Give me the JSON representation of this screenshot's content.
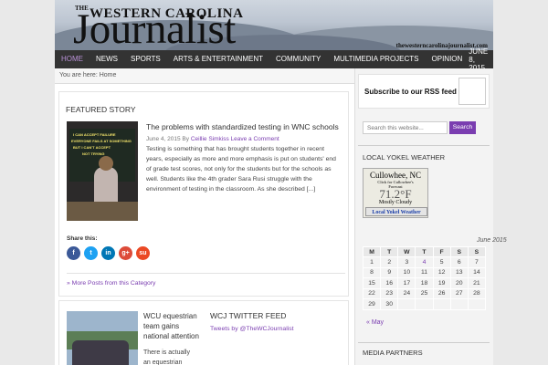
{
  "header": {
    "logo_the": "THE",
    "logo_western": "WESTERN CAROLINA",
    "logo_main": "Journalist",
    "logo_url": "thewesterncarolinajournalist.com"
  },
  "nav": {
    "items": [
      "Home",
      "News",
      "Sports",
      "Arts & Entertainment",
      "Community",
      "Multimedia Projects",
      "Opinion"
    ],
    "date": "June 8, 2015"
  },
  "breadcrumb": "You are here: Home",
  "featured": {
    "section_title": "Featured Story",
    "image_text": [
      "I CAN ACCEPT FAILURE",
      "EVERYONE FAILS AT SOMETHING",
      "BUT I CAN'T ACCEPT",
      "NOT TRYING"
    ],
    "title": "The problems with standardized testing in WNC schools",
    "date": "June 4, 2015",
    "by": "By",
    "author": "Ceillie Simkiss",
    "comment_link": "Leave a Comment",
    "excerpt": "Testing is something that has brought students together in recent years, especially as more and more emphasis is put on students' end of grade test scores, not only for the students but for the schools as well. Students like the 4th grader Sara Rusi struggle with the environment of testing in the classroom. As she described [...]",
    "share_label": "Share this:",
    "share_buttons": [
      "f",
      "t",
      "in",
      "g+",
      "su"
    ],
    "more_posts": "More Posts from this Category"
  },
  "second": {
    "title": "WCU equestrian team gains national attention",
    "excerpt": "There is actually an equestrian",
    "twitter_title": "WCJ Twitter Feed",
    "twitter_link": "Tweets by @TheWCJournalist"
  },
  "sidebar": {
    "rss_text": "Subscribe to our RSS feed",
    "search_placeholder": "Search this website...",
    "search_button": "Search",
    "weather_title": "Local Yokel Weather",
    "weather": {
      "city": "Cullowhee, NC",
      "sub1": "Click for Cullowhee's",
      "sub2": "Forecast",
      "temp": "71.2°F",
      "condition": "Mostly Cloudy",
      "link": "Local Yokel Weather"
    },
    "calendar": {
      "caption": "June 2015",
      "days": [
        "M",
        "T",
        "W",
        "T",
        "F",
        "S",
        "S"
      ],
      "weeks": [
        [
          "1",
          "2",
          "3",
          "4",
          "5",
          "6",
          "7"
        ],
        [
          "8",
          "9",
          "10",
          "11",
          "12",
          "13",
          "14"
        ],
        [
          "15",
          "16",
          "17",
          "18",
          "19",
          "20",
          "21"
        ],
        [
          "22",
          "23",
          "24",
          "25",
          "26",
          "27",
          "28"
        ],
        [
          "29",
          "30",
          "",
          "",
          "",
          "",
          ""
        ]
      ],
      "prev": "« May"
    },
    "media_title": "Media Partners"
  },
  "colors": {
    "accent": "#7a3db0",
    "nav_bg": "#333333",
    "share_fb": "#3b5998",
    "share_tw": "#1da1f2",
    "share_in": "#0077b5",
    "share_gp": "#dd4b39",
    "share_su": "#eb4924"
  }
}
